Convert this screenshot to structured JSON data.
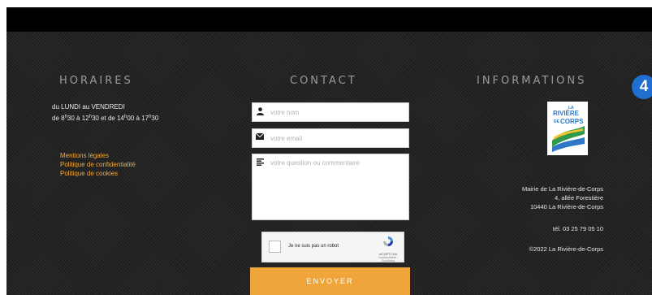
{
  "horaires": {
    "title": "HORAIRES",
    "days": "du LUNDI au VENDREDI",
    "time_prefix": "de 8",
    "sup_1": "h",
    "time_1": "30 à 12",
    "sup_2": "h",
    "time_2": "30 et de 14",
    "sup_3": "h",
    "time_3": "00 à 17",
    "sup_4": "h",
    "time_4": "30"
  },
  "links": [
    "Mentions légales",
    "Politique de confidentialité",
    "Politique de cookies"
  ],
  "contact": {
    "title": "CONTACT",
    "name_placeholder": "votre nom",
    "email_placeholder": "votre email",
    "message_placeholder": "votre question ou commentaire",
    "captcha_label": "Je ne suis pas un robot",
    "captcha_brand": "reCAPTCHA",
    "captcha_terms": "Confidentialité - Conditions",
    "submit_label": "ENVOYER"
  },
  "informations": {
    "title": "INFORMATIONS",
    "logo_line_1": "LA",
    "logo_line_2": "RIVIÈRE",
    "logo_line_3": "DE",
    "logo_line_4": "CORPS",
    "address_lines": [
      "Mairie de La Rivière-de-Corps",
      "4, allée Forestière",
      "10440 La Rivière-de-Corps"
    ],
    "phone": "tél. 03 25 79 05 10",
    "copyright": "©2022 La Rivière-de-Corps"
  },
  "step_badge": "4",
  "colors": {
    "accent": "#f0a53a",
    "badge": "#1f6fd1"
  },
  "icons": {
    "name": "user-icon",
    "email": "envelope-icon",
    "message": "text-lines-icon",
    "captcha": "recaptcha-logo-icon"
  }
}
